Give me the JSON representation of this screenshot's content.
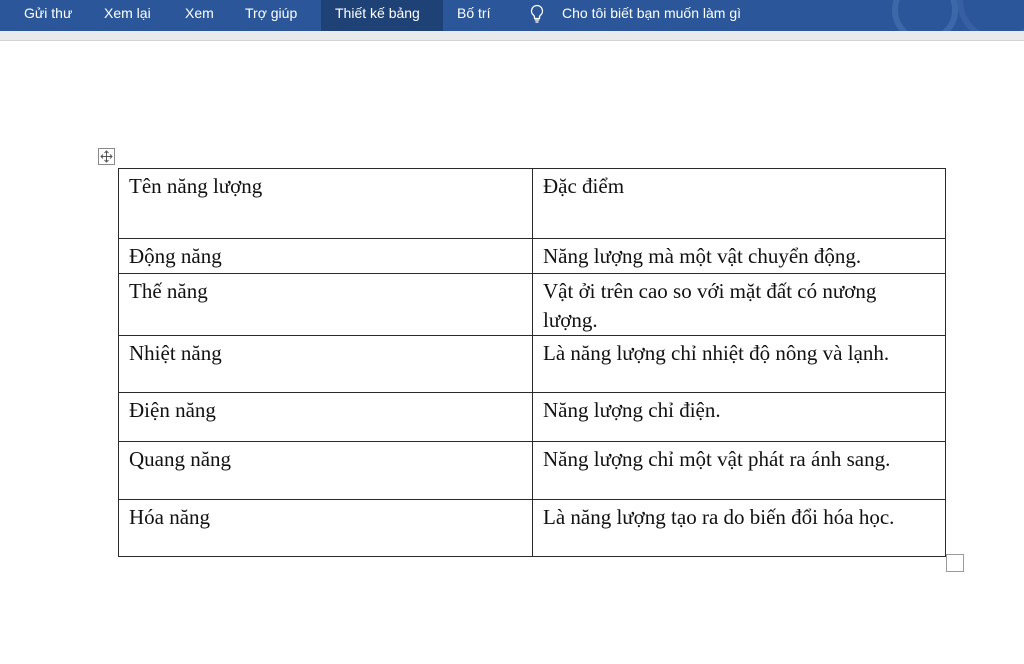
{
  "ribbon": {
    "tabs": [
      {
        "label": "Gửi thư",
        "selected": false
      },
      {
        "label": "Xem lại",
        "selected": false
      },
      {
        "label": "Xem",
        "selected": false
      },
      {
        "label": "Trợ giúp",
        "selected": false
      },
      {
        "label": "Thiết kế bảng",
        "selected": true
      },
      {
        "label": "Bố trí",
        "selected": false
      }
    ],
    "tell_me": {
      "icon": "lightbulb-icon",
      "label": "Cho tôi biết bạn muốn làm gì"
    },
    "colors": {
      "ribbon_bg": "#2b579a",
      "selected_tab_bg": "#1e4176",
      "text": "#ffffff"
    }
  },
  "table": {
    "header": {
      "col1": "Tên năng lượng",
      "col2": "Đặc điểm"
    },
    "rows": [
      {
        "name": "Động năng",
        "desc": "Năng lượng mà một vật chuyển động."
      },
      {
        "name": "Thế năng",
        "desc": "Vật ởi trên cao so với mặt đất có nương lượng."
      },
      {
        "name": "Nhiệt năng",
        "desc": "Là năng lượng chỉ nhiệt độ nông và lạnh."
      },
      {
        "name": "Điện năng",
        "desc": "Năng lượng chỉ điện."
      },
      {
        "name": "Quang năng",
        "desc": "Năng lượng chỉ một vật phát ra ánh sang."
      },
      {
        "name": "Hóa năng",
        "desc": "Là năng lượng tạo ra do biến đổi hóa học."
      }
    ]
  },
  "icons": {
    "move_handle": "move-arrows-icon",
    "resize_handle": "table-resize-icon"
  }
}
